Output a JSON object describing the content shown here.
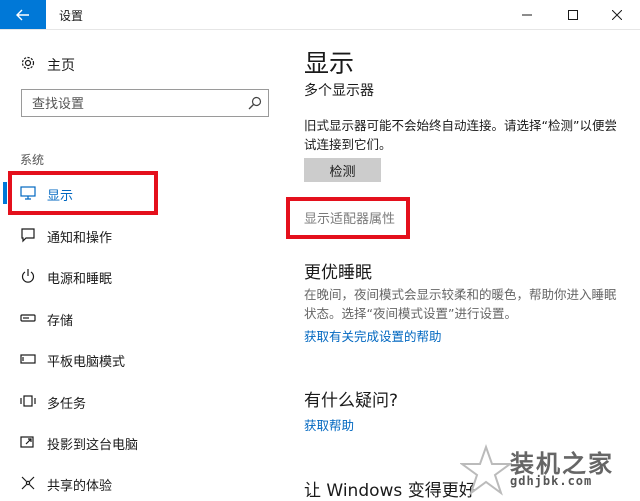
{
  "window": {
    "title": "设置",
    "back_icon": "back-arrow-icon",
    "accent": "#0078d7",
    "controls": [
      "minimize-icon",
      "maximize-icon",
      "close-icon"
    ]
  },
  "sidebar": {
    "home_label": "主页",
    "search_placeholder": "查找设置",
    "section_label": "系统",
    "items": [
      {
        "label": "显示",
        "icon": "monitor-icon",
        "selected": true
      },
      {
        "label": "通知和操作",
        "icon": "notification-icon"
      },
      {
        "label": "电源和睡眠",
        "icon": "power-icon"
      },
      {
        "label": "存储",
        "icon": "storage-icon"
      },
      {
        "label": "平板电脑模式",
        "icon": "tablet-icon"
      },
      {
        "label": "多任务",
        "icon": "multitask-icon"
      },
      {
        "label": "投影到这台电脑",
        "icon": "project-icon"
      },
      {
        "label": "共享的体验",
        "icon": "shared-experience-icon"
      }
    ]
  },
  "main": {
    "title": "显示",
    "multi_display_heading": "多个显示器",
    "multi_display_text": "旧式显示器可能不会始终自动连接。请选择“检测”以便尝试连接到它们。",
    "detect_button": "检测",
    "adapter_link": "显示适配器属性",
    "sleep_heading": "更优睡眠",
    "sleep_text": "在晚间，夜间模式会显示较柔和的暖色，帮助你进入睡眠状态。选择“夜间模式设置”进行设置。",
    "sleep_link": "获取有关完成设置的帮助",
    "question_heading": "有什么疑问?",
    "help_link": "获取帮助",
    "better_heading": "让 Windows 变得更好"
  },
  "annotation_color": "#e4101c",
  "watermark": {
    "text": "装机之家",
    "url": "gdhjbk.com"
  }
}
